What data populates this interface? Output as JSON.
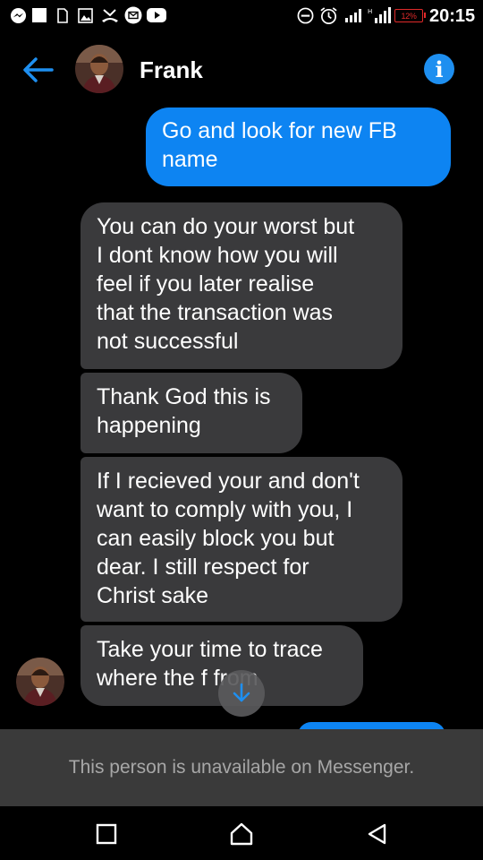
{
  "status_bar": {
    "time": "20:15",
    "battery": "12%",
    "left_icons": [
      "messenger-icon",
      "notification-square-icon",
      "sim-icon",
      "gallery-icon",
      "missed-call-icon",
      "email-icon",
      "youtube-icon"
    ],
    "right_icons": [
      "dnd-icon",
      "alarm-icon",
      "signal-icon",
      "signal-icon"
    ]
  },
  "header": {
    "contact_name": "Frank",
    "back_icon": "arrow-left-icon",
    "info_icon": "info-icon",
    "info_glyph": "i"
  },
  "messages": [
    {
      "direction": "outgoing",
      "text": "Go and look for new FB\nname"
    },
    {
      "direction": "incoming",
      "text": "You can do your worst but\nI dont know how you will\nfeel if you later realise\nthat the transaction was\nnot successful"
    },
    {
      "direction": "incoming",
      "text": "Thank God this is\nhappening"
    },
    {
      "direction": "incoming",
      "text": "If I recieved your and don't\nwant to comply with you, I\ncan easily block you but\ndear. I still respect for\nChrist sake"
    },
    {
      "direction": "incoming",
      "text": "Take your time to trace\nwhere the f      from"
    },
    {
      "direction": "outgoing",
      "text": ""
    }
  ],
  "scroll_button_icon": "arrow-down-icon",
  "banner": {
    "text": "This person is unavailable on Messenger."
  },
  "navbar": {
    "icons": [
      "recents-icon",
      "home-icon",
      "back-icon"
    ]
  },
  "colors": {
    "outgoing_bubble": "#0d84f2",
    "incoming_bubble": "#3a3a3c",
    "accent": "#1e8ff0",
    "battery_low": "#e02a2a"
  }
}
